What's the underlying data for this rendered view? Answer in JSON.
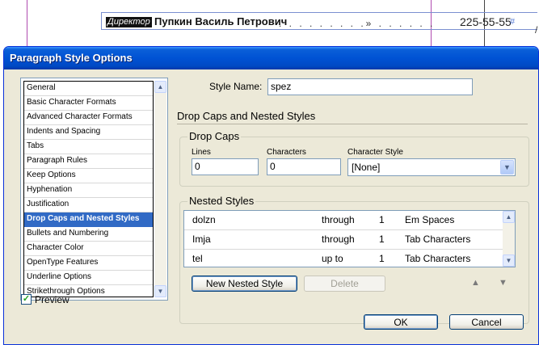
{
  "document": {
    "role": "Директор",
    "dash": "–",
    "name": "Пупкин Василь Петрович",
    "dots": ". . . . . . . . .» . . . . . .",
    "phone": "225-55-55",
    "hash": "#",
    "margin_mark": "/"
  },
  "dialog": {
    "title": "Paragraph Style Options",
    "categories": [
      "General",
      "Basic Character Formats",
      "Advanced Character Formats",
      "Indents and Spacing",
      "Tabs",
      "Paragraph Rules",
      "Keep Options",
      "Hyphenation",
      "Justification",
      "Drop Caps and Nested Styles",
      "Bullets and Numbering",
      "Character Color",
      "OpenType Features",
      "Underline Options",
      "Strikethrough Options"
    ],
    "selected_category": "Drop Caps and Nested Styles",
    "style_name_label": "Style Name:",
    "style_name_value": "spez",
    "section_title": "Drop Caps and Nested Styles",
    "drop_caps": {
      "title": "Drop Caps",
      "lines_label": "Lines",
      "lines_value": "0",
      "characters_label": "Characters",
      "characters_value": "0",
      "char_style_label": "Character Style",
      "char_style_value": "[None]"
    },
    "nested_styles": {
      "title": "Nested Styles",
      "rows": [
        {
          "style": "dolzn",
          "mode": "through",
          "count": "1",
          "unit": "Em Spaces"
        },
        {
          "style": "Imja",
          "mode": "through",
          "count": "1",
          "unit": "Tab Characters"
        },
        {
          "style": "tel",
          "mode": "up to",
          "count": "1",
          "unit": "Tab Characters"
        }
      ],
      "new_button": "New Nested Style",
      "delete_button": "Delete",
      "up_icon": "▲",
      "down_icon": "▼"
    },
    "preview_label": "Preview",
    "preview_checked": true,
    "ok_label": "OK",
    "cancel_label": "Cancel"
  }
}
